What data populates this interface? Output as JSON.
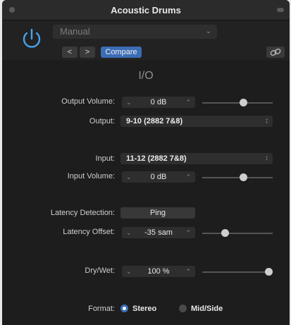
{
  "window": {
    "title": "Acoustic Drums"
  },
  "header": {
    "preset": "Manual",
    "prev_label": "<",
    "next_label": ">",
    "compare_label": "Compare"
  },
  "section_title": "I/O",
  "controls": {
    "output_volume": {
      "label": "Output Volume:",
      "value": "0 dB",
      "level": 0.6
    },
    "output": {
      "label": "Output:",
      "value": "9-10 (2882 7&8)"
    },
    "input": {
      "label": "Input:",
      "value": "11-12 (2882 7&8)"
    },
    "input_volume": {
      "label": "Input Volume:",
      "value": "0 dB",
      "level": 0.6
    },
    "latency_detection": {
      "label": "Latency Detection:",
      "button": "Ping"
    },
    "latency_offset": {
      "label": "Latency Offset:",
      "value": "-35 sam",
      "level": 0.3
    },
    "dry_wet": {
      "label": "Dry/Wet:",
      "value": "100 %",
      "level": 1.0
    },
    "format": {
      "label": "Format:",
      "options": [
        "Stereo",
        "Mid/Side"
      ],
      "selected": "Stereo"
    }
  },
  "colors": {
    "accent": "#3b6db5",
    "power": "#4aa3f0"
  }
}
